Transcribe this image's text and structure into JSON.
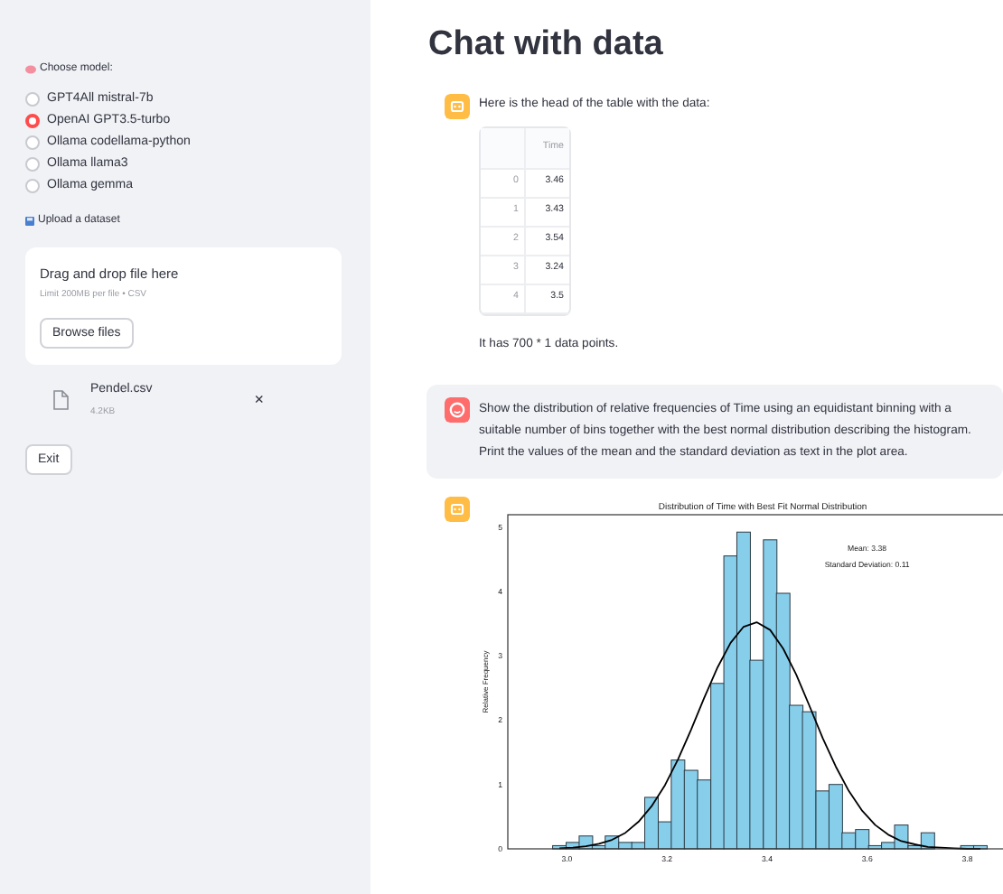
{
  "sidebar": {
    "model_label": "Choose model:",
    "models": [
      {
        "label": "GPT4All mistral-7b",
        "selected": false
      },
      {
        "label": "OpenAI GPT3.5-turbo",
        "selected": true
      },
      {
        "label": "Ollama codellama-python",
        "selected": false
      },
      {
        "label": "Ollama llama3",
        "selected": false
      },
      {
        "label": "Ollama gemma",
        "selected": false
      }
    ],
    "upload_label": "Upload a dataset",
    "uploader": {
      "title": "Drag and drop file here",
      "hint": "Limit 200MB per file • CSV",
      "button": "Browse files"
    },
    "file": {
      "name": "Pendel.csv",
      "size": "4.2KB",
      "remove": "×"
    },
    "exit_button": "Exit"
  },
  "main": {
    "title": "Chat with data",
    "messages": [
      {
        "kind": "assistant",
        "text": "Here is the head of the table with the data:",
        "table": {
          "columns": [
            "",
            "Time"
          ],
          "rows": [
            [
              "0",
              "3.46"
            ],
            [
              "1",
              "3.43"
            ],
            [
              "2",
              "3.54"
            ],
            [
              "3",
              "3.24"
            ],
            [
              "4",
              "3.5"
            ]
          ]
        },
        "footer": "It has 700 * 1 data points."
      },
      {
        "kind": "user",
        "text": "Show the distribution of relative frequencies of Time using an equidistant binning with a suitable number of bins together with the best normal distribution describing the histogram. Print the values of the mean and the standard deviation as text in the plot area."
      },
      {
        "kind": "assistant",
        "chart_data": {
          "type": "bar",
          "title": "Distribution of Time with Best Fit Normal Distribution",
          "ylabel": "Relative Frequency",
          "x": [
            2.985,
            3.012,
            3.038,
            3.064,
            3.09,
            3.117,
            3.143,
            3.169,
            3.196,
            3.222,
            3.248,
            3.274,
            3.301,
            3.327,
            3.353,
            3.379,
            3.406,
            3.432,
            3.458,
            3.484,
            3.511,
            3.537,
            3.563,
            3.59,
            3.616,
            3.642,
            3.668,
            3.695,
            3.721,
            3.747,
            3.773,
            3.8,
            3.826
          ],
          "series": [
            {
              "type": "bar",
              "color": "#87ceeb",
              "values": [
                0.05,
                0.1,
                0.2,
                0.05,
                0.2,
                0.1,
                0.1,
                0.8,
                0.42,
                1.38,
                1.22,
                1.07,
                2.57,
                4.55,
                4.92,
                2.93,
                4.8,
                3.97,
                2.23,
                2.13,
                0.9,
                1.0,
                0.25,
                0.3,
                0.05,
                0.1,
                0.37,
                0.05,
                0.25,
                0,
                0,
                0.05,
                0.05
              ]
            },
            {
              "type": "line",
              "color": "#000000",
              "values": [
                0.01,
                0.02,
                0.04,
                0.08,
                0.14,
                0.25,
                0.42,
                0.66,
                0.99,
                1.39,
                1.85,
                2.34,
                2.82,
                3.2,
                3.45,
                3.52,
                3.4,
                3.11,
                2.71,
                2.23,
                1.72,
                1.28,
                0.9,
                0.59,
                0.37,
                0.22,
                0.12,
                0.07,
                0.03,
                0.02,
                0.01,
                0,
                0
              ]
            }
          ],
          "xlim": [
            2.882,
            3.9
          ],
          "ylim": [
            0,
            5.19
          ],
          "xticks": [
            {
              "value": 3.0,
              "label": "3.0"
            },
            {
              "value": 3.2,
              "label": "3.2"
            },
            {
              "value": 3.4,
              "label": "3.4"
            },
            {
              "value": 3.6,
              "label": "3.6"
            },
            {
              "value": 3.8,
              "label": "3.8"
            }
          ],
          "yticks": [
            {
              "value": 0,
              "label": "0"
            },
            {
              "value": 1,
              "label": "1"
            },
            {
              "value": 2,
              "label": "2"
            },
            {
              "value": 3,
              "label": "3"
            },
            {
              "value": 4,
              "label": "4"
            },
            {
              "value": 5,
              "label": "5"
            }
          ],
          "annotations": [
            "Mean: 3.38",
            "Standard Deviation: 0.11"
          ]
        }
      }
    ]
  }
}
